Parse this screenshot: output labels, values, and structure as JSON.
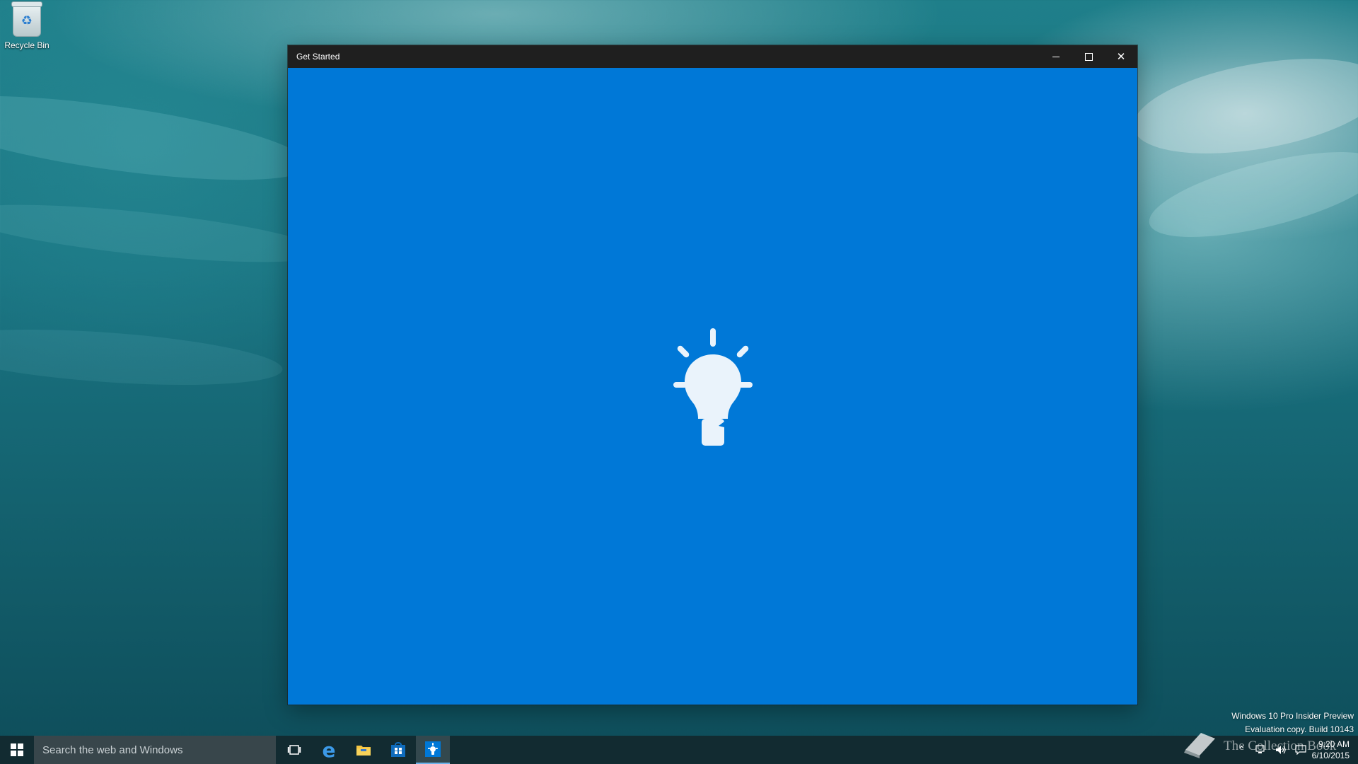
{
  "desktop": {
    "icons": [
      {
        "label": "Recycle Bin",
        "icon": "recycle-bin-icon"
      }
    ],
    "watermark": {
      "line1": "Windows 10 Pro Insider Preview",
      "line2": "Evaluation copy. Build 10143"
    },
    "brand_overlay": "The Collection Book"
  },
  "window": {
    "title": "Get Started",
    "buttons": [
      "minimize",
      "maximize",
      "close"
    ],
    "accent_color": "#0078d7",
    "splash_icon": "lightbulb-icon"
  },
  "taskbar": {
    "search_placeholder": "Search the web and Windows",
    "pinned": [
      {
        "name": "task-view",
        "icon": "task-view-icon"
      },
      {
        "name": "edge",
        "icon": "edge-icon"
      },
      {
        "name": "file-explorer",
        "icon": "folder-icon"
      },
      {
        "name": "store",
        "icon": "store-icon"
      },
      {
        "name": "get-started",
        "icon": "lightbulb-icon",
        "active": true
      }
    ],
    "tray_icons": [
      "chevron-up-icon",
      "network-icon",
      "volume-icon",
      "action-center-icon"
    ],
    "clock": {
      "time": "9:20 AM",
      "date": "6/10/2015"
    }
  }
}
